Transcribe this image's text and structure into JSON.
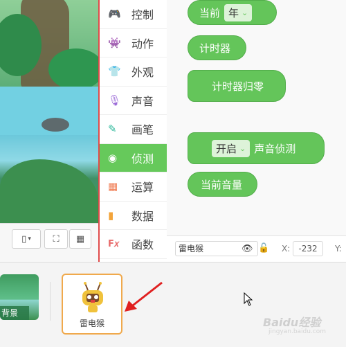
{
  "categories": [
    {
      "label": "控制",
      "icon": "gamepad-icon",
      "color": "#4aa3df"
    },
    {
      "label": "动作",
      "icon": "ghost-icon",
      "color": "#e05a5a"
    },
    {
      "label": "外观",
      "icon": "shirt-icon",
      "color": "#c65bd4"
    },
    {
      "label": "声音",
      "icon": "microphone-icon",
      "color": "#9b6ad8"
    },
    {
      "label": "画笔",
      "icon": "pen-icon",
      "color": "#2bb89a"
    },
    {
      "label": "侦测",
      "icon": "target-icon",
      "color": "#ffffff",
      "active": true
    },
    {
      "label": "运算",
      "icon": "calculator-icon",
      "color": "#f07d54"
    },
    {
      "label": "数据",
      "icon": "bar-chart-icon",
      "color": "#f3a43a"
    },
    {
      "label": "函数",
      "icon": "function-icon",
      "color": "#e86a6a"
    }
  ],
  "blocks": {
    "current": {
      "label": "当前",
      "dropdown": "年"
    },
    "timer": {
      "label": "计时器"
    },
    "reset_timer": {
      "label": "计时器归零"
    },
    "sound_detect": {
      "dropdown": "开启",
      "label": "声音侦测"
    },
    "loudness": {
      "label": "当前音量"
    }
  },
  "sprite_info": {
    "name": "雷电猴",
    "x_label": "X:",
    "x_value": "-232",
    "y_label": "Y:"
  },
  "tray": {
    "background_label": "背景",
    "sprite_name": "雷电猴"
  },
  "watermark": {
    "main": "Baidu经验",
    "sub": "jingyan.baidu.com"
  },
  "colors": {
    "accent_green": "#64c55a",
    "selected_border": "#f0a94c",
    "arrow_red": "#e02020"
  }
}
